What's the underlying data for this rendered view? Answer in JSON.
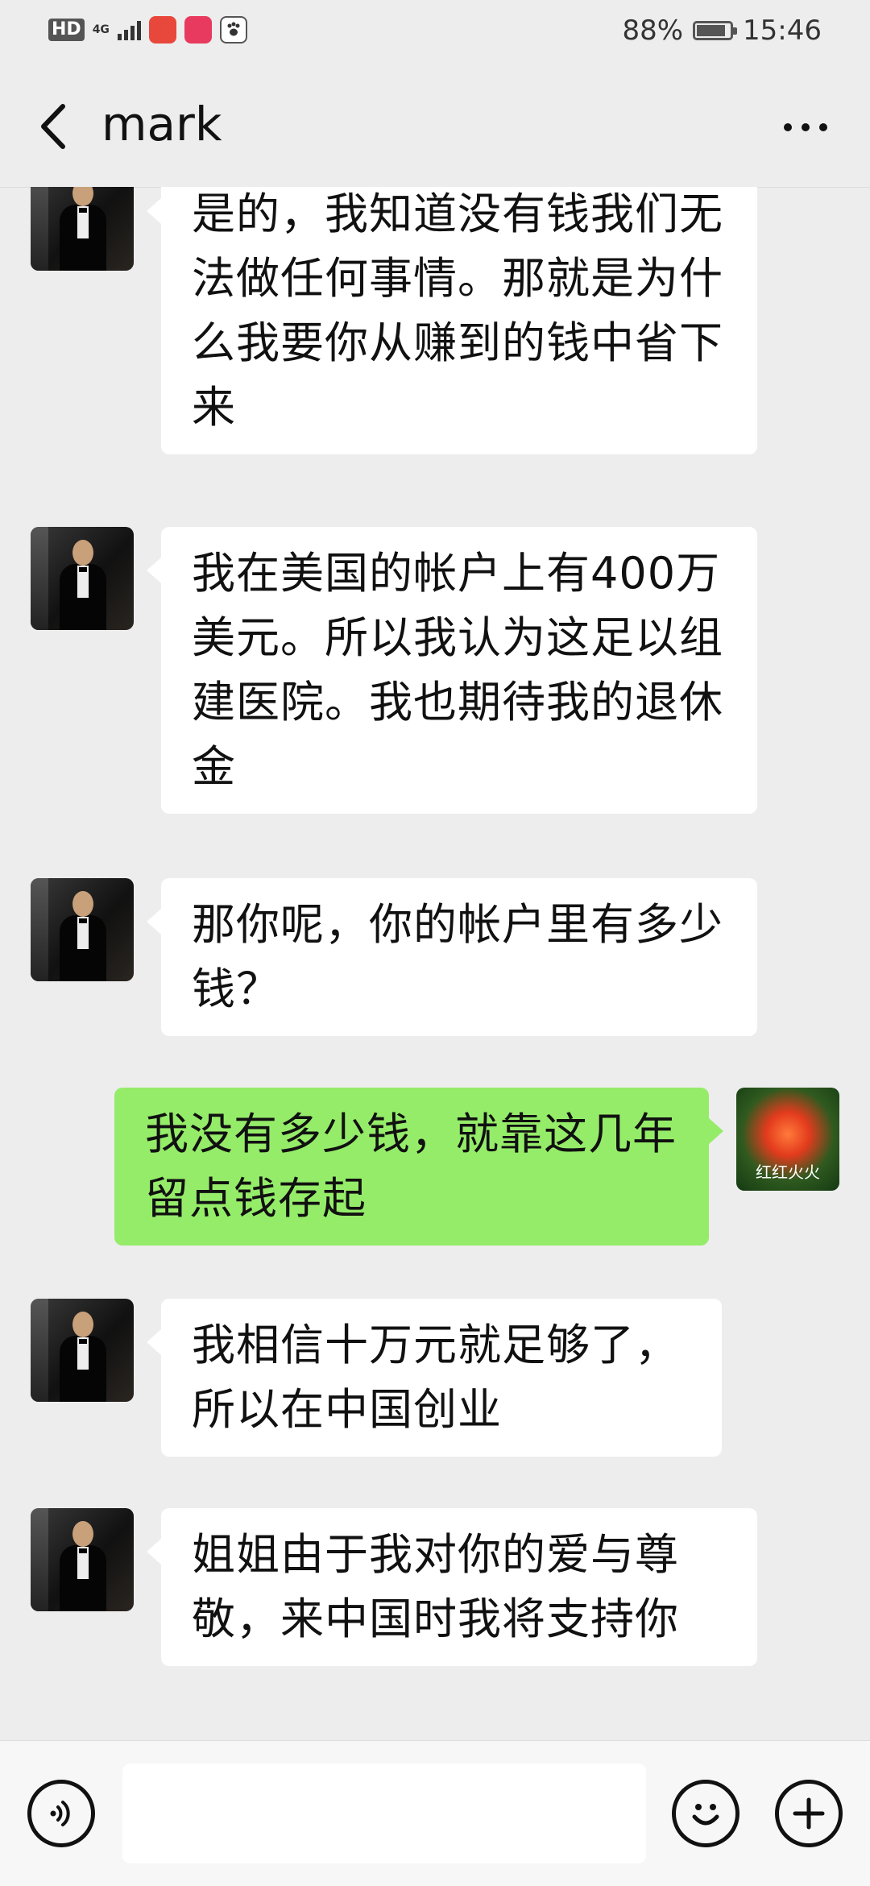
{
  "status_bar": {
    "hd": "HD",
    "network": "4G",
    "battery_text": "88%",
    "battery_level": 0.88,
    "time": "15:46"
  },
  "header": {
    "title": "mark",
    "back_icon": "chevron-left-icon",
    "more_icon": "more-dots-icon"
  },
  "messages": [
    {
      "sender": "mark",
      "side": "left",
      "text": "是的，我知道没有钱我们无法做任何事情。那就是为什么我要你从赚到的钱中省下来"
    },
    {
      "sender": "mark",
      "side": "left",
      "text": "我在美国的帐户上有400万美元。所以我认为这足以组建医院。我也期待我的退休金"
    },
    {
      "sender": "mark",
      "side": "left",
      "text": "那你呢，你的帐户里有多少钱？"
    },
    {
      "sender": "self",
      "side": "right",
      "text": "我没有多少钱，就靠这几年留点钱存起",
      "avatar_caption": "红红火火"
    },
    {
      "sender": "mark",
      "side": "left",
      "text": "我相信十万元就足够了，所以在中国创业"
    },
    {
      "sender": "mark",
      "side": "left",
      "text": "姐姐由于我对你的爱与尊敬，来中国时我将支持你"
    }
  ],
  "bottom_bar": {
    "voice_icon": "voice-icon",
    "input_value": "",
    "emoji_icon": "emoji-icon",
    "plus_icon": "plus-icon"
  },
  "colors": {
    "background": "#ededed",
    "incoming_bubble": "#ffffff",
    "outgoing_bubble": "#95ec69"
  }
}
